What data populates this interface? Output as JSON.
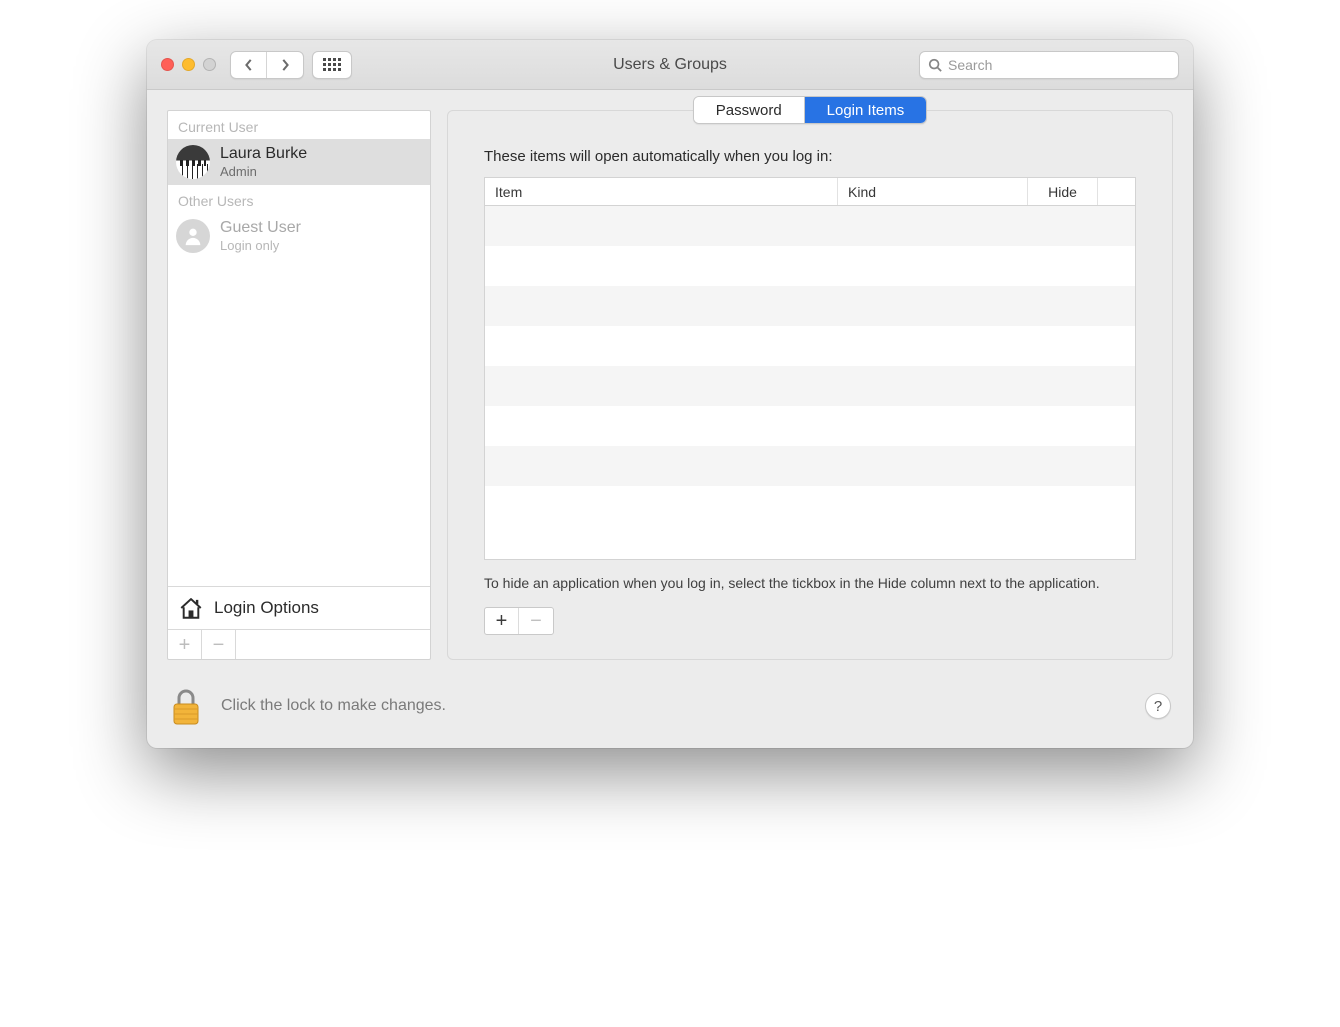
{
  "window": {
    "title": "Users & Groups",
    "search_placeholder": "Search"
  },
  "sidebar": {
    "current_user_label": "Current User",
    "other_users_label": "Other Users",
    "current_user": {
      "name": "Laura Burke",
      "role": "Admin"
    },
    "other_users": [
      {
        "name": "Guest User",
        "role": "Login only"
      }
    ],
    "login_options_label": "Login Options"
  },
  "tabs": {
    "password": "Password",
    "login_items": "Login Items"
  },
  "main": {
    "description": "These items will open automatically when you log in:",
    "columns": {
      "item": "Item",
      "kind": "Kind",
      "hide": "Hide"
    },
    "hint": "To hide an application when you log in, select the tickbox in the Hide column next to the application."
  },
  "footer": {
    "lock_text": "Click the lock to make changes.",
    "help": "?"
  }
}
